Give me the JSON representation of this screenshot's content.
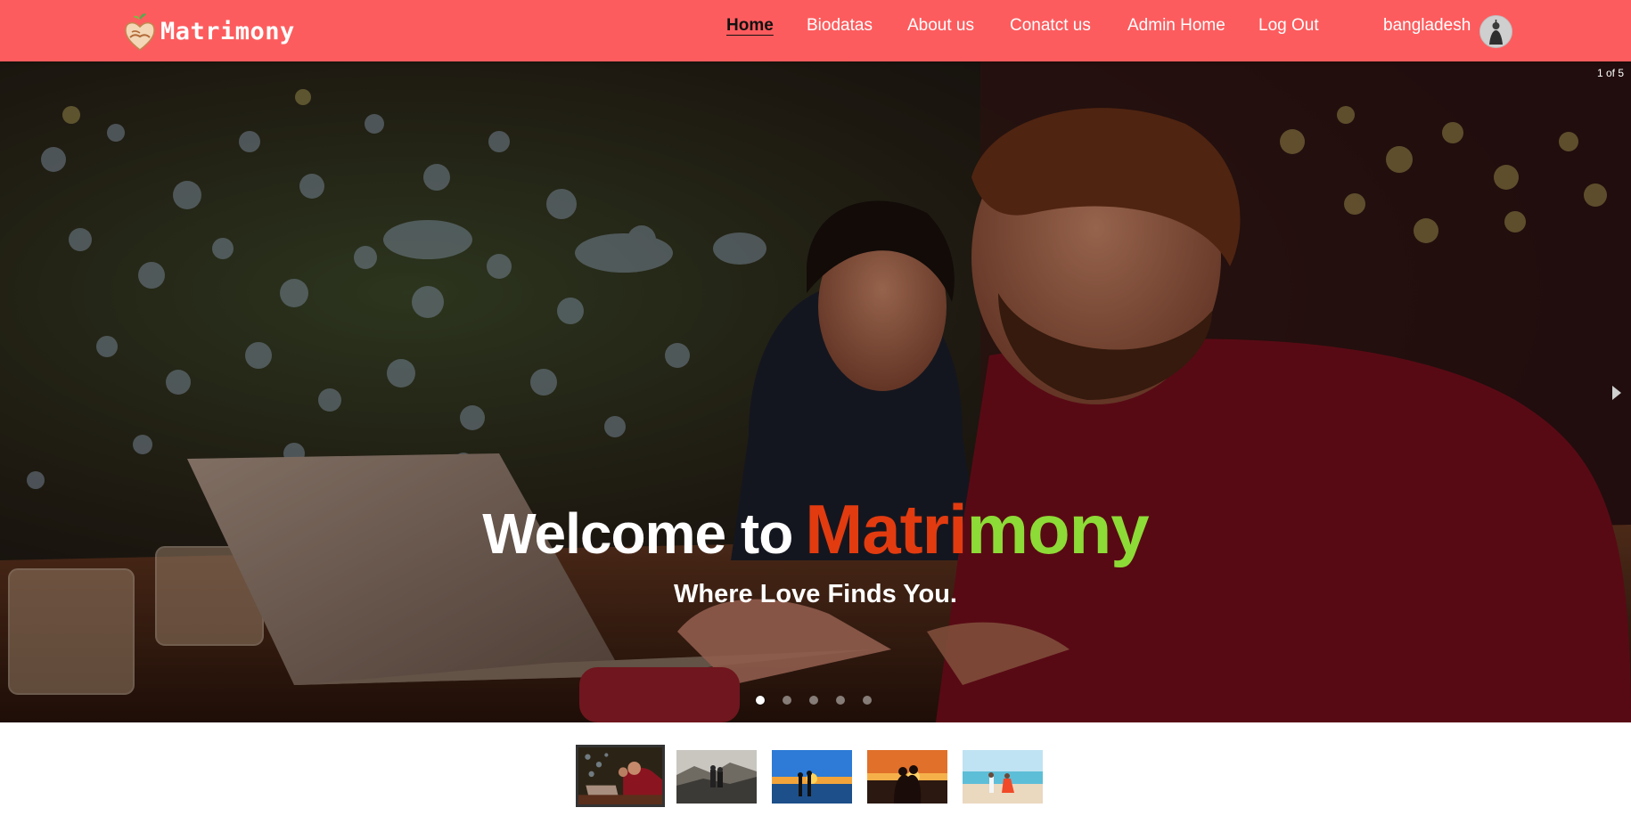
{
  "brand": {
    "name": "Matrimony",
    "logo_icon": "heart-hands-logo-icon"
  },
  "nav": {
    "items": [
      {
        "label": "Home",
        "active": true
      },
      {
        "label": "Biodatas"
      },
      {
        "label": "About us"
      },
      {
        "label": "Conatct us"
      },
      {
        "label": "Admin Home"
      },
      {
        "label": "Log Out"
      }
    ],
    "user_name": "bangladesh",
    "avatar_icon": "user-avatar"
  },
  "carousel": {
    "counter": "1 of 5",
    "title_prefix": "Welcome to",
    "title_brand_part1": "Matri",
    "title_brand_part2": "mony",
    "subtitle": "Where Love Finds You.",
    "slides_total": 5,
    "active_index": 0,
    "next_icon": "chevron-right-icon"
  },
  "thumbnails": [
    {
      "scene": "couple-laptop-night",
      "active": true
    },
    {
      "scene": "couple-mountain-view"
    },
    {
      "scene": "couple-beach-sunset-blue"
    },
    {
      "scene": "couple-orange-sunset"
    },
    {
      "scene": "couple-beach-daylight"
    }
  ],
  "colors": {
    "navbar_bg": "#fd5c5e",
    "brand_orange": "#e23b10",
    "brand_green": "#8ddb36",
    "text_white": "#ffffff"
  }
}
